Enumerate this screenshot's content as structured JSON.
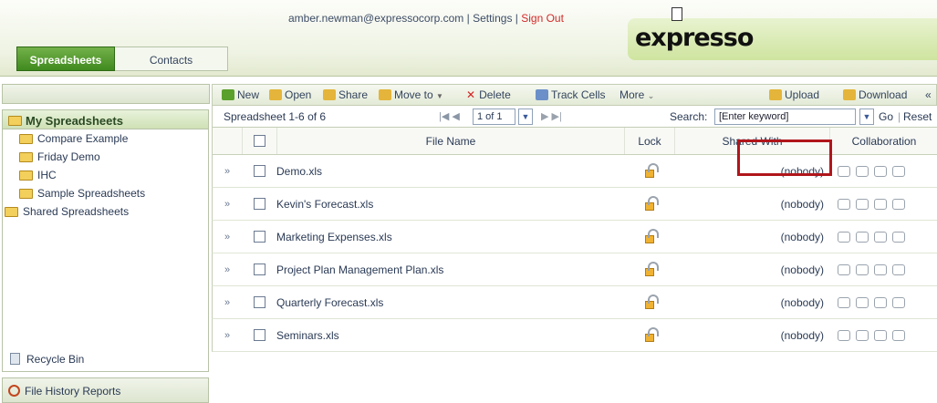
{
  "header": {
    "user_email": "amber.newman@expressocorp.com",
    "separator": "|",
    "settings": "Settings",
    "sign_out": "Sign Out",
    "logo": "expresso"
  },
  "tabs": [
    {
      "label": "Spreadsheets"
    },
    {
      "label": "Contacts"
    }
  ],
  "sidebar": {
    "my_spreadsheets": "My Spreadsheets",
    "items": [
      {
        "label": "Compare Example"
      },
      {
        "label": "Friday Demo"
      },
      {
        "label": "IHC"
      },
      {
        "label": "Sample Spreadsheets"
      }
    ],
    "shared": "Shared Spreadsheets",
    "recycle": "Recycle Bin",
    "file_history": "File History Reports"
  },
  "toolbar": {
    "new": "New",
    "open": "Open",
    "share": "Share",
    "move_to": "Move to",
    "delete": "Delete",
    "track_cells": "Track Cells",
    "more": "More",
    "upload": "Upload",
    "download": "Download",
    "collapse": "«"
  },
  "pager": {
    "range": "Spreadsheet 1-6 of 6",
    "page": "1 of 1",
    "search_label": "Search:",
    "search_value": "[Enter keyword]",
    "go": "Go",
    "reset": "Reset"
  },
  "columns": {
    "file_name": "File Name",
    "lock": "Lock",
    "shared_with": "Shared With",
    "collaboration": "Collaboration"
  },
  "files": [
    {
      "name": "Demo.xls",
      "shared": "(nobody)"
    },
    {
      "name": "Kevin's Forecast.xls",
      "shared": "(nobody)"
    },
    {
      "name": "Marketing Expenses.xls",
      "shared": "(nobody)"
    },
    {
      "name": "Project Plan Management Plan.xls",
      "shared": "(nobody)"
    },
    {
      "name": "Quarterly Forecast.xls",
      "shared": "(nobody)"
    },
    {
      "name": "Seminars.xls",
      "shared": "(nobody)"
    }
  ]
}
